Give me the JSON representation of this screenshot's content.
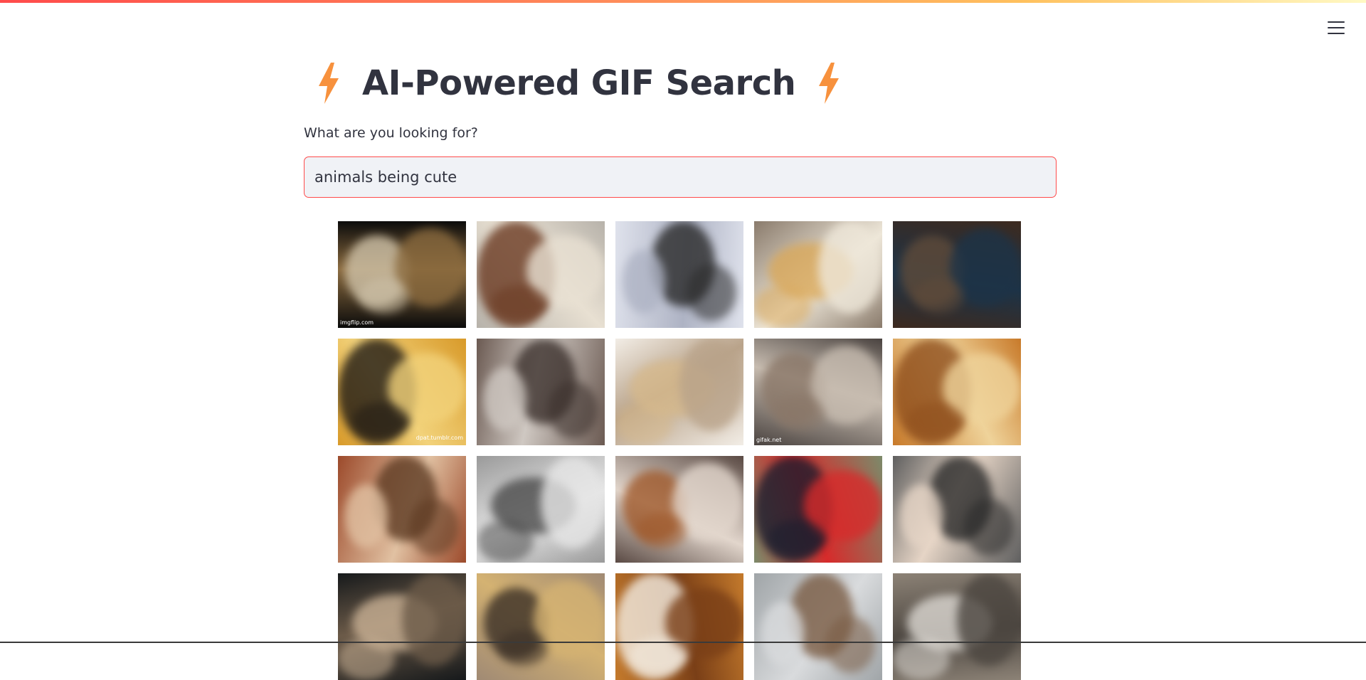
{
  "page": {
    "title": "AI-Powered GIF Search",
    "accent_color": "#ff4b4b",
    "bolt_color": "#f7913d"
  },
  "search": {
    "label": "What are you looking for?",
    "value": "animals being cute",
    "border_color": "#ff4b4b"
  },
  "menu": {
    "icon": "hamburger-menu-icon"
  },
  "gifs": [
    {
      "subject": "guinea-pigs-nuzzling",
      "palette": [
        "#0b0b0b",
        "#cfc2a8",
        "#8a6a3e"
      ],
      "caption": "imgflip.com"
    },
    {
      "subject": "dog-feeding-lamb",
      "palette": [
        "#b7b2aa",
        "#6b3a22",
        "#e8e0d2"
      ],
      "caption": ""
    },
    {
      "subject": "animals-in-snow",
      "palette": [
        "#dfe2ec",
        "#2a2a2a",
        "#aeb3c4"
      ],
      "caption": ""
    },
    {
      "subject": "cheetah-and-dog",
      "palette": [
        "#8a7b6c",
        "#d9a85a",
        "#eee7d9"
      ],
      "caption": ""
    },
    {
      "subject": "cat-in-dark-room",
      "palette": [
        "#3d2a1f",
        "#5f4b3a",
        "#1d3347"
      ],
      "caption": ""
    },
    {
      "subject": "cat-and-dog-on-couch",
      "palette": [
        "#d89a2a",
        "#201a14",
        "#f2d27a"
      ],
      "caption": "dpat.tumblr.com"
    },
    {
      "subject": "person-hugging-kitten",
      "palette": [
        "#6b5a52",
        "#3b302c",
        "#cfc8c2"
      ],
      "caption": ""
    },
    {
      "subject": "fluffy-puppy-waving",
      "palette": [
        "#f2ede6",
        "#d6b98c",
        "#b9a38a"
      ],
      "caption": ""
    },
    {
      "subject": "red-panda-on-branch",
      "palette": [
        "#4a4340",
        "#8a7768",
        "#c7bcb0"
      ],
      "caption": "gifak.net"
    },
    {
      "subject": "kittens-playing-with-shadow",
      "palette": [
        "#c87a2a",
        "#8f4f1d",
        "#efd39a"
      ],
      "caption": ""
    },
    {
      "subject": "slow-loris-eating",
      "palette": [
        "#9c4a2b",
        "#5d3a22",
        "#e1c1a2"
      ],
      "caption": ""
    },
    {
      "subject": "kitten-black-and-white",
      "palette": [
        "#9a9a9a",
        "#4b4b4b",
        "#e6e6e6"
      ],
      "caption": ""
    },
    {
      "subject": "puppy-on-bed",
      "palette": [
        "#5a4a44",
        "#a05a2c",
        "#e2d6cc"
      ],
      "caption": ""
    },
    {
      "subject": "pug-in-hoodie",
      "palette": [
        "#7c8a6a",
        "#1a1d2e",
        "#d72b2b"
      ],
      "caption": ""
    },
    {
      "subject": "dog-being-petted",
      "palette": [
        "#5f5f5f",
        "#2a2a2a",
        "#e6d5c6"
      ],
      "caption": ""
    },
    {
      "subject": "small-dog-closeup",
      "palette": [
        "#16191b",
        "#c8b094",
        "#6b5a48"
      ],
      "caption": ""
    },
    {
      "subject": "goat-closeup",
      "palette": [
        "#a08a74",
        "#3a2f26",
        "#d4b272"
      ],
      "caption": ""
    },
    {
      "subject": "fluffy-white-puppy",
      "palette": [
        "#c47a2c",
        "#f4ede2",
        "#7a3f17"
      ],
      "caption": ""
    },
    {
      "subject": "blurry-pet-by-door",
      "palette": [
        "#a0a5a8",
        "#7a5c44",
        "#d9dbdd"
      ],
      "caption": ""
    },
    {
      "subject": "cat-and-dogs-together",
      "palette": [
        "#8c8276",
        "#dcd8d2",
        "#4c4640"
      ],
      "caption": ""
    }
  ]
}
